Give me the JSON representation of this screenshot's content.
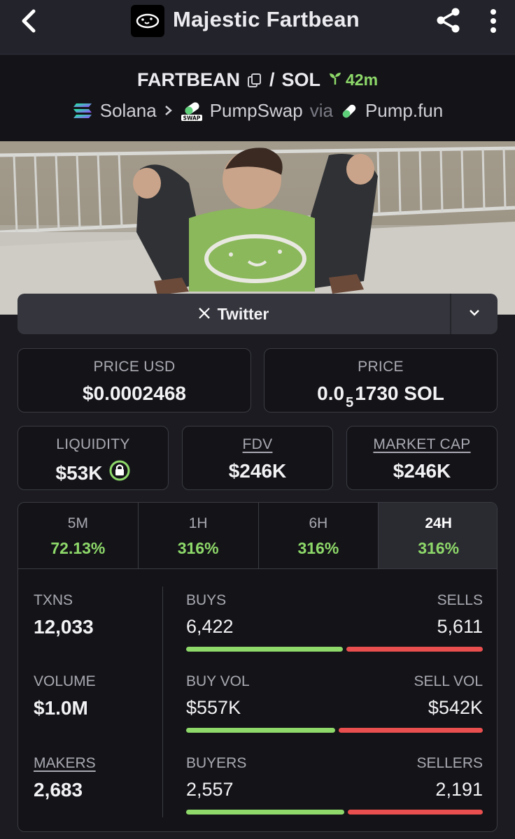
{
  "header": {
    "title": "Majestic Fartbean"
  },
  "pair": {
    "base": "FARTBEAN",
    "separator": "/",
    "quote": "SOL",
    "age": "42m",
    "chain": "Solana",
    "dex": "PumpSwap",
    "dex_badge": "SWAP",
    "via": "via",
    "launchpad": "Pump.fun"
  },
  "links": {
    "twitter": "Twitter"
  },
  "price": {
    "usd_label": "PRICE USD",
    "usd_value": "$0.0002468",
    "native_label": "PRICE",
    "native_prefix": "0.0",
    "native_subscript": "5",
    "native_digits": "1730 SOL"
  },
  "metrics": {
    "liquidity_label": "LIQUIDITY",
    "liquidity_value": "$53K",
    "fdv_label": "FDV",
    "fdv_value": "$246K",
    "mcap_label": "MARKET CAP",
    "mcap_value": "$246K"
  },
  "periods": [
    {
      "label": "5M",
      "change": "72.13%"
    },
    {
      "label": "1H",
      "change": "316%"
    },
    {
      "label": "6H",
      "change": "316%"
    },
    {
      "label": "24H",
      "change": "316%"
    }
  ],
  "active_period": "24H",
  "stats": {
    "txns_label": "TXNS",
    "txns_value": "12,033",
    "buys_label": "BUYS",
    "buys_value": "6,422",
    "sells_label": "SELLS",
    "sells_value": "5,611",
    "buys_fraction": 0.534,
    "volume_label": "VOLUME",
    "volume_value": "$1.0M",
    "buyvol_label": "BUY VOL",
    "buyvol_value": "$557K",
    "sellvol_label": "SELL VOL",
    "sellvol_value": "$542K",
    "buyvol_fraction": 0.507,
    "makers_label": "MAKERS",
    "makers_value": "2,683",
    "buyers_label": "BUYERS",
    "buyers_value": "2,557",
    "sellers_label": "SELLERS",
    "sellers_value": "2,191",
    "buyers_fraction": 0.538
  },
  "colors": {
    "positive": "#8ed96a",
    "negative": "#ea4f4f",
    "background": "#1b1b21"
  },
  "icons": [
    "back-arrow-icon",
    "app-logo-icon",
    "share-icon",
    "more-vertical-icon",
    "copy-icon",
    "seedling-icon",
    "solana-icon",
    "pumpswap-icon",
    "pill-icon",
    "x-logo-icon",
    "chevron-down-icon",
    "lock-icon"
  ]
}
